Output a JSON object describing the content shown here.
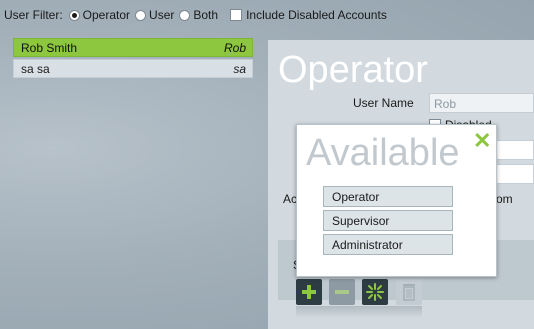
{
  "filter": {
    "label": "User Filter:",
    "options": [
      {
        "label": "Operator",
        "checked": true
      },
      {
        "label": "User",
        "checked": false
      },
      {
        "label": "Both",
        "checked": false
      }
    ],
    "include_disabled_label": "Include Disabled Accounts",
    "include_disabled_checked": false
  },
  "users": [
    {
      "name": "Rob  Smith",
      "alias": "Rob",
      "selected": true
    },
    {
      "name": "sa  sa",
      "alias": "sa",
      "selected": false
    }
  ],
  "panel": {
    "title": "Operator",
    "username_label": "User Name",
    "username_value": "Rob",
    "disabled_label_partial": "Disabled",
    "account_label_partial": "Ac",
    "email_partial": "om"
  },
  "popup": {
    "title": "Available",
    "close_icon": "close-x-icon",
    "roles": [
      "Operator",
      "Supervisor",
      "Administrator"
    ]
  },
  "roles_section_partial": "S",
  "toolbar_icons": [
    "add-icon",
    "remove-icon",
    "reset-icon",
    "trash-icon"
  ],
  "colors": {
    "accent": "#8dc63f",
    "panel": "#d2dadf",
    "dark_button": "#2d3b43"
  }
}
